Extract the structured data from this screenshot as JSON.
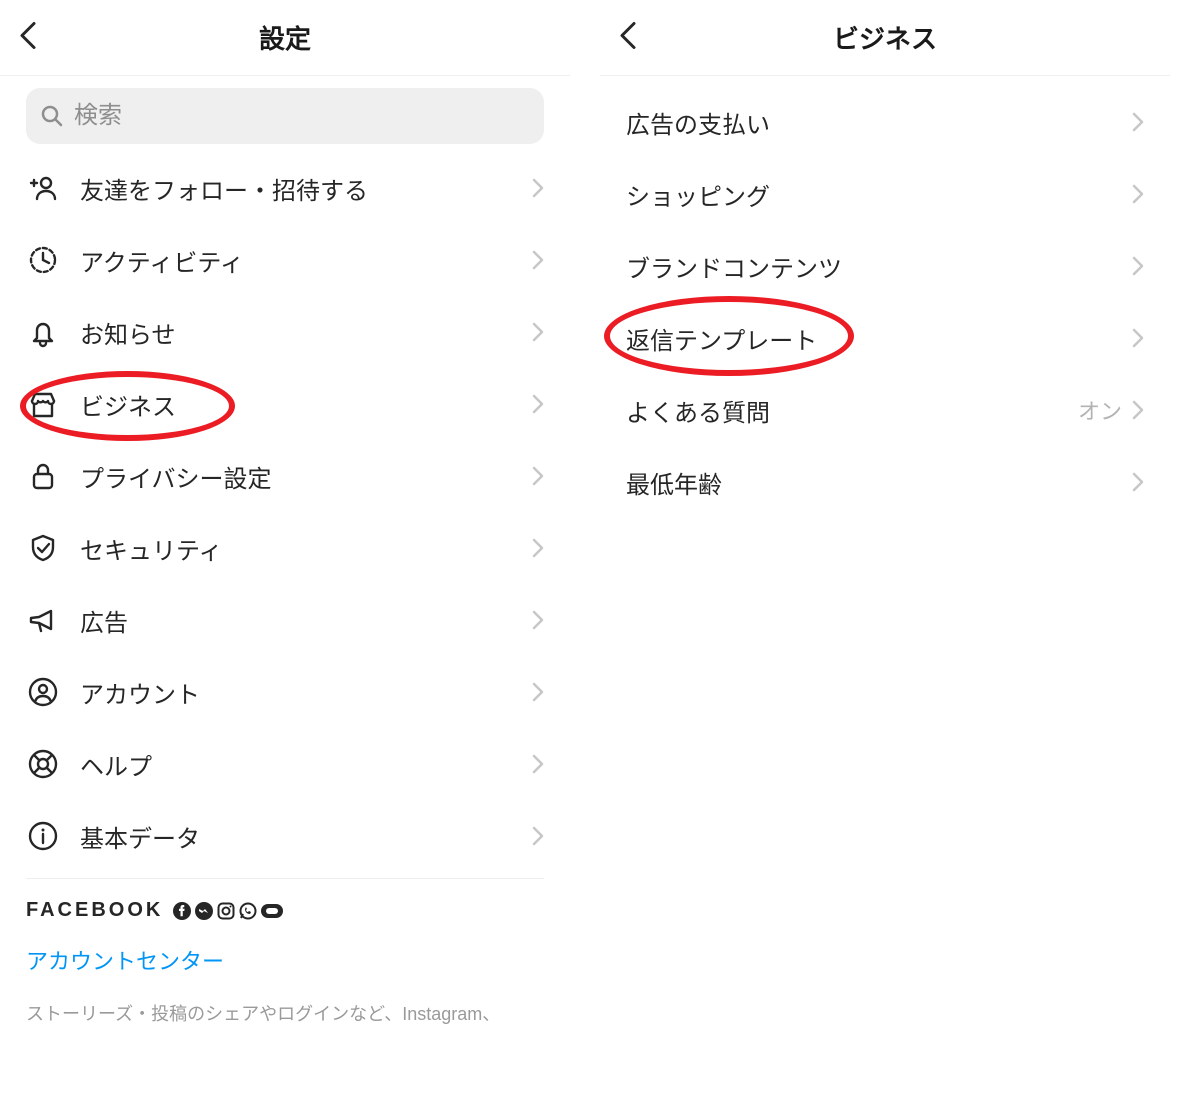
{
  "left": {
    "title": "設定",
    "search_placeholder": "検索",
    "items": [
      {
        "label": "友達をフォロー・招待する"
      },
      {
        "label": "アクティビティ"
      },
      {
        "label": "お知らせ"
      },
      {
        "label": "ビジネス"
      },
      {
        "label": "プライバシー設定"
      },
      {
        "label": "セキュリティ"
      },
      {
        "label": "広告"
      },
      {
        "label": "アカウント"
      },
      {
        "label": "ヘルプ"
      },
      {
        "label": "基本データ"
      }
    ],
    "facebook_label": "FACEBOOK",
    "account_center": "アカウントセンター",
    "footnote": "ストーリーズ・投稿のシェアやログインなど、Instagram、"
  },
  "right": {
    "title": "ビジネス",
    "items": [
      {
        "label": "広告の支払い",
        "value": ""
      },
      {
        "label": "ショッピング",
        "value": ""
      },
      {
        "label": "ブランドコンテンツ",
        "value": ""
      },
      {
        "label": "返信テンプレート",
        "value": ""
      },
      {
        "label": "よくある質問",
        "value": "オン"
      },
      {
        "label": "最低年齢",
        "value": ""
      }
    ]
  },
  "highlights": {
    "left_item_index": 3,
    "right_item_index": 3
  }
}
